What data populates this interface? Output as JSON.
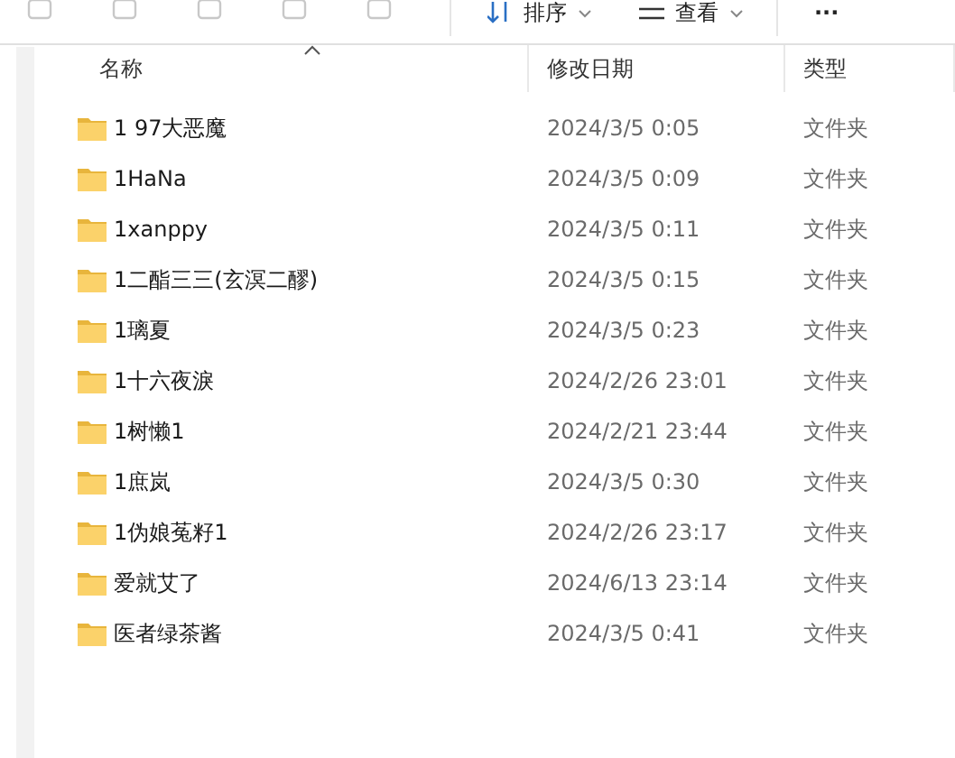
{
  "toolbar": {
    "sort_label": "排序",
    "view_label": "查看",
    "more_label": "···"
  },
  "columns": [
    {
      "label": "名称",
      "sorted": true
    },
    {
      "label": "修改日期",
      "sorted": false
    },
    {
      "label": "类型",
      "sorted": false
    }
  ],
  "rows": [
    {
      "name": "1 97大恶魔",
      "modified": "2024/3/5 0:05",
      "type": "文件夹"
    },
    {
      "name": "1HaNa",
      "modified": "2024/3/5 0:09",
      "type": "文件夹"
    },
    {
      "name": "1xanppy",
      "modified": "2024/3/5 0:11",
      "type": "文件夹"
    },
    {
      "name": "1二酯三三(玄溟二醪)",
      "modified": "2024/3/5 0:15",
      "type": "文件夹"
    },
    {
      "name": "1璃夏",
      "modified": "2024/3/5 0:23",
      "type": "文件夹"
    },
    {
      "name": "1十六夜淚",
      "modified": "2024/2/26 23:01",
      "type": "文件夹"
    },
    {
      "name": "1树懒1",
      "modified": "2024/2/21 23:44",
      "type": "文件夹"
    },
    {
      "name": "1庶岚",
      "modified": "2024/3/5 0:30",
      "type": "文件夹"
    },
    {
      "name": "1伪娘菟籽1",
      "modified": "2024/2/26 23:17",
      "type": "文件夹"
    },
    {
      "name": "爱就艾了",
      "modified": "2024/6/13 23:14",
      "type": "文件夹"
    },
    {
      "name": "医者绿茶酱",
      "modified": "2024/3/5 0:41",
      "type": "文件夹"
    }
  ]
}
